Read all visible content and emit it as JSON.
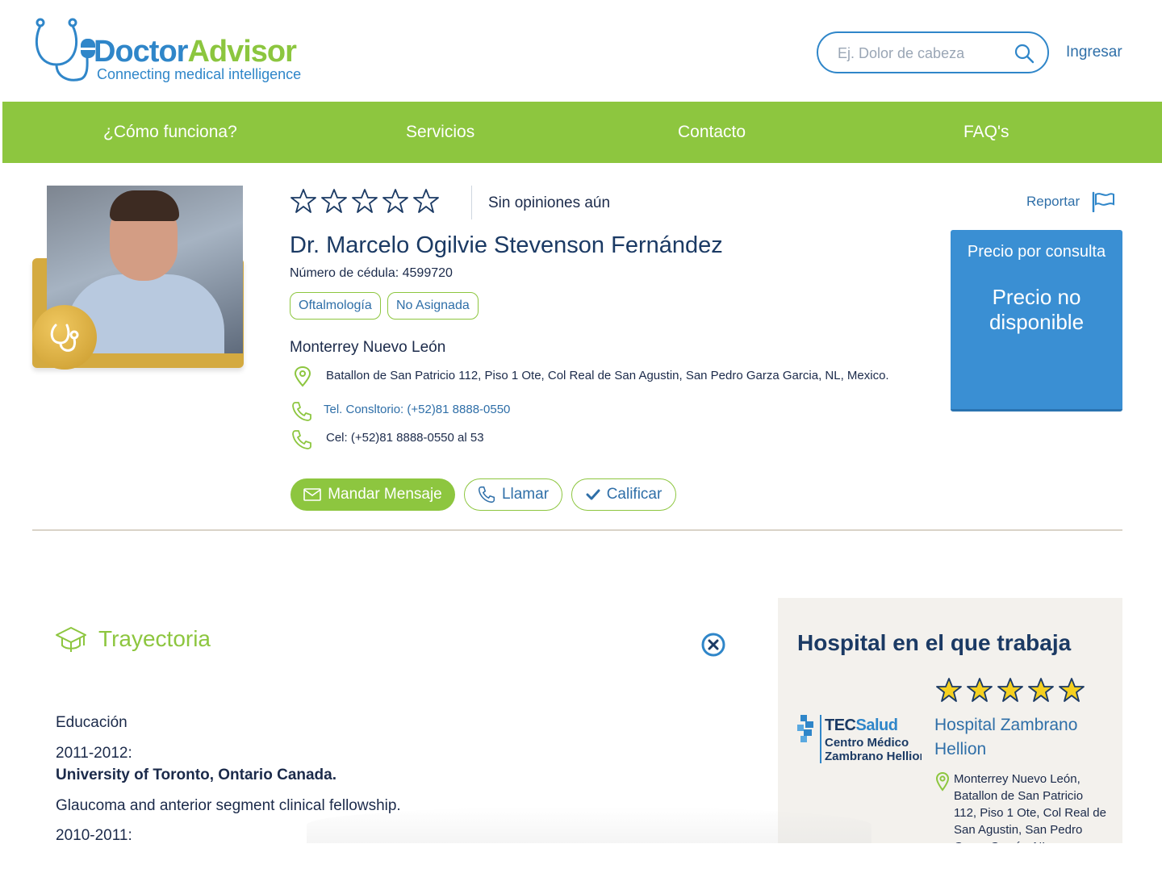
{
  "brand": {
    "name_part1": "Doctor",
    "name_part2": "Advisor",
    "tagline": "Connecting medical intelligence",
    "color_blue": "#2f86c9",
    "color_green": "#8cc63f"
  },
  "header": {
    "search_placeholder": "Ej. Dolor de cabeza",
    "login_label": "Ingresar"
  },
  "nav": {
    "items": [
      {
        "label": "¿Cómo funciona?"
      },
      {
        "label": "Servicios"
      },
      {
        "label": "Contacto"
      },
      {
        "label": "FAQ's"
      }
    ]
  },
  "doctor": {
    "rating_stars": 0,
    "reviews_text": "Sin opiniones aún",
    "report_label": "Reportar",
    "name": "Dr. Marcelo Ogilvie Stevenson Fernández",
    "cedula": "Número de cédula: 4599720",
    "tags": [
      "Oftalmología",
      "No Asignada"
    ],
    "city": "Monterrey Nuevo León",
    "address": "Batallon de San Patricio 112, Piso 1 Ote, Col Real de San Agustin, San Pedro Garza Garcia, NL, Mexico.",
    "tel": "Tel. Consltorio: (+52)81 8888-0550",
    "cel": "Cel: (+52)81 8888-0550 al 53"
  },
  "actions": {
    "message_label": "Mandar Mensaje",
    "call_label": "Llamar",
    "rate_label": "Calificar"
  },
  "price": {
    "title": "Precio por consulta",
    "value": "Precio no disponible"
  },
  "trajectory": {
    "title": "Trayectoria",
    "education_label": "Educación",
    "entries": [
      {
        "years": "2011-2012:",
        "school": "University of Toronto, Ontario Canada.",
        "desc": "Glaucoma and anterior segment clinical fellowship."
      },
      {
        "years": "2010-2011:"
      }
    ]
  },
  "hospital": {
    "heading": "Hospital en el que trabaja",
    "rating_stars": 5,
    "logo_brand_1": "TEC",
    "logo_brand_2": "Salud",
    "logo_line_1": "Centro Médico",
    "logo_line_2": "Zambrano Hellion",
    "name": "Hospital Zambrano Hellion",
    "address": "Monterrey Nuevo León, Batallon de San Patricio 112, Piso 1 Ote, Col Real de San Agustin, San Pedro Garza García, NL"
  }
}
